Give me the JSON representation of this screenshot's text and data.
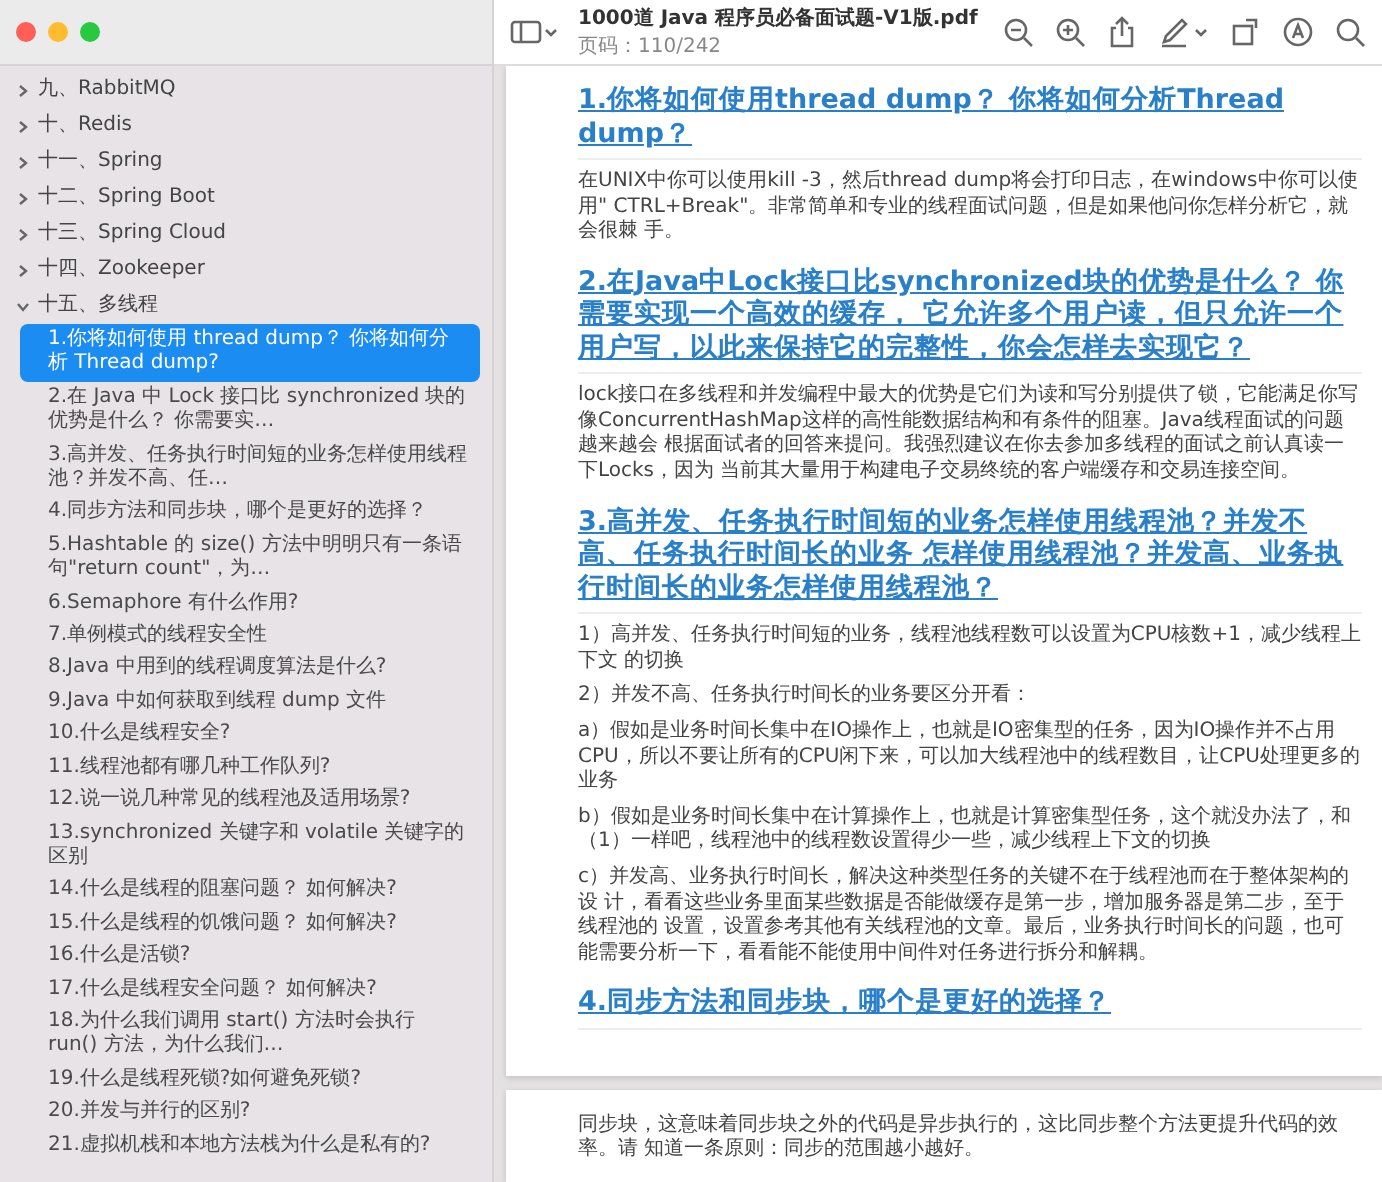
{
  "sidebar": {
    "items": [
      {
        "label": "九、RabbitMQ",
        "expanded": false
      },
      {
        "label": "十、Redis",
        "expanded": false
      },
      {
        "label": "十一、Spring",
        "expanded": false
      },
      {
        "label": "十二、Spring Boot",
        "expanded": false
      },
      {
        "label": "十三、Spring Cloud",
        "expanded": false
      },
      {
        "label": "十四、Zookeeper",
        "expanded": false
      },
      {
        "label": "十五、多线程",
        "expanded": true,
        "children": [
          {
            "label": "1.你将如何使用 thread dump？ 你将如何分析 Thread dump?",
            "selected": true
          },
          {
            "label": "2.在 Java 中 Lock 接口比 synchronized 块的优势是什么？ 你需要实…",
            "selected": false
          },
          {
            "label": "3.高并发、任务执行时间短的业务怎样使用线程池？并发不高、任…",
            "selected": false
          },
          {
            "label": "4.同步方法和同步块，哪个是更好的选择？",
            "selected": false
          },
          {
            "label": "5.Hashtable 的 size() 方法中明明只有一条语句\"return count\"，为…",
            "selected": false
          },
          {
            "label": "6.Semaphore 有什么作用?",
            "selected": false
          },
          {
            "label": "7.单例模式的线程安全性",
            "selected": false
          },
          {
            "label": "8.Java 中用到的线程调度算法是什么?",
            "selected": false
          },
          {
            "label": "9.Java 中如何获取到线程 dump 文件",
            "selected": false
          },
          {
            "label": "10.什么是线程安全?",
            "selected": false
          },
          {
            "label": "11.线程池都有哪几种工作队列?",
            "selected": false
          },
          {
            "label": "12.说一说几种常见的线程池及适用场景?",
            "selected": false
          },
          {
            "label": "13.synchronized 关键字和 volatile 关键字的区别",
            "selected": false
          },
          {
            "label": "14.什么是线程的阻塞问题？ 如何解决?",
            "selected": false
          },
          {
            "label": "15.什么是线程的饥饿问题？ 如何解决?",
            "selected": false
          },
          {
            "label": "16.什么是活锁?",
            "selected": false
          },
          {
            "label": "17.什么是线程安全问题？ 如何解决?",
            "selected": false
          },
          {
            "label": "18.为什么我们调用 start() 方法时会执行 run() 方法，为什么我们…",
            "selected": false
          },
          {
            "label": "19.什么是线程死锁?如何避免死锁?",
            "selected": false
          },
          {
            "label": "20.并发与并行的区别?",
            "selected": false
          },
          {
            "label": "21.虚拟机栈和本地方法栈为什么是私有的?",
            "selected": false
          }
        ]
      }
    ]
  },
  "toolbar": {
    "title": "1000道 Java 程序员必备面试题-V1版.pdf",
    "page_label": "页码：110/242"
  },
  "document": {
    "pages": [
      {
        "blocks": [
          {
            "kind": "heading",
            "text": "1.你将如何使用thread dump？ 你将如何分析Thread dump？"
          },
          {
            "kind": "paragraph",
            "text": "在UNIX中你可以使用kill -3，然后thread dump将会打印日志，在windows中你可以使用\" CTRL+Break\"。非常简单和专业的线程面试问题，但是如果他问你怎样分析它，就会很棘 手。"
          },
          {
            "kind": "heading",
            "text": "2.在Java中Lock接口比synchronized块的优势是什么？ 你需要实现一个高效的缓存， 它允许多个用户读，但只允许一个用户写，以此来保持它的完整性，你会怎样去实现它？"
          },
          {
            "kind": "paragraph",
            "text": "lock接口在多线程和并发编程中最大的优势是它们为读和写分别提供了锁，它能满足你写像ConcurrentHashMap这样的高性能数据结构和有条件的阻塞。Java线程面试的问题越来越会 根据面试者的回答来提问。我强烈建议在你去参加多线程的面试之前认真读一下Locks，因为 当前其大量用于构建电子交易终统的客户端缓存和交易连接空间。"
          },
          {
            "kind": "heading",
            "text": "3.高并发、任务执行时间短的业务怎样使用线程池？并发不高、任务执行时间长的业务 怎样使用线程池？并发高、业务执行时间长的业务怎样使用线程池？"
          },
          {
            "kind": "paragraph",
            "text": "1）高并发、任务执行时间短的业务，线程池线程数可以设置为CPU核数+1，减少线程上下文 的切换"
          },
          {
            "kind": "paragraph",
            "text": "2）并发不高、任务执行时间长的业务要区分开看："
          },
          {
            "kind": "paragraph",
            "text": "a）假如是业务时间长集中在IO操作上，也就是IO密集型的任务，因为IO操作并不占用CPU，所以不要让所有的CPU闲下来，可以加大线程池中的线程数目，让CPU处理更多的业务"
          },
          {
            "kind": "paragraph",
            "text": "b）假如是业务时间长集中在计算操作上，也就是计算密集型任务，这个就没办法了，和（1）一样吧，线程池中的线程数设置得少一些，减少线程上下文的切换"
          },
          {
            "kind": "paragraph",
            "text": "c）并发高、业务执行时间长，解决这种类型任务的关键不在于线程池而在于整体架构的设 计，看看这些业务里面某些数据是否能做缓存是第一步，增加服务器是第二步，至于线程池的 设置，设置参考其他有关线程池的文章。最后，业务执行时间长的问题，也可能需要分析一下，看看能不能使用中间件对任务进行拆分和解耦。"
          },
          {
            "kind": "heading",
            "text": "4.同步方法和同步块，哪个是更好的选择？"
          }
        ]
      },
      {
        "blocks": [
          {
            "kind": "paragraph",
            "text": "同步块，这意味着同步块之外的代码是异步执行的，这比同步整个方法更提升代码的效率。请 知道一条原则：同步的范围越小越好。"
          }
        ]
      }
    ]
  }
}
